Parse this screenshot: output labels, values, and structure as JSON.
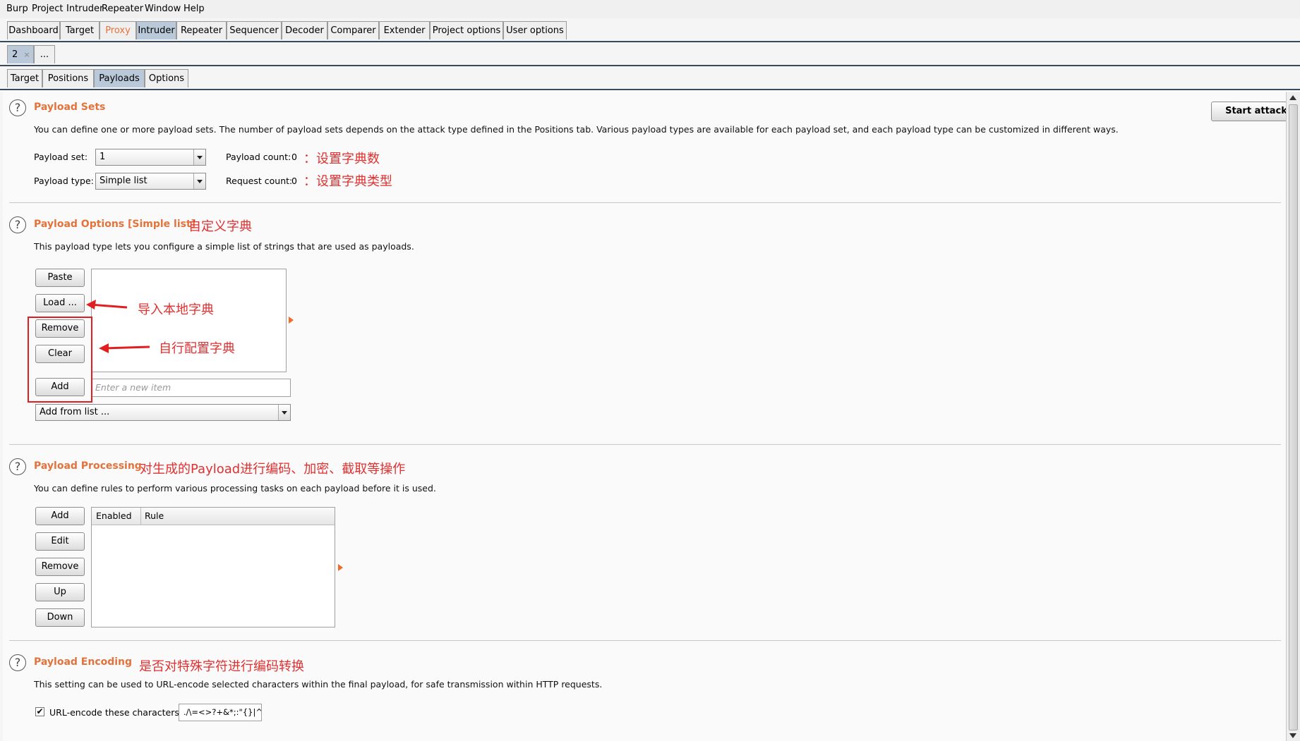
{
  "menu": [
    "Burp",
    "Project",
    "Intruder",
    "Repeater",
    "Window",
    "Help"
  ],
  "main_tabs": [
    "Dashboard",
    "Target",
    "Proxy",
    "Intruder",
    "Repeater",
    "Sequencer",
    "Decoder",
    "Comparer",
    "Extender",
    "Project options",
    "User options"
  ],
  "attack_tabs": {
    "current": "2",
    "close": "×",
    "more": "..."
  },
  "sub_tabs": [
    "Target",
    "Positions",
    "Payloads",
    "Options"
  ],
  "help_glyph": "?",
  "start_attack": "Start attack",
  "payload_sets": {
    "title": "Payload Sets",
    "description": "You can define one or more payload sets. The number of payload sets depends on the attack type defined in the Positions tab. Various payload types are available for each payload set, and each payload type can be customized in different ways.",
    "set_label": "Payload set:",
    "set_value": "1",
    "type_label": "Payload type:",
    "type_value": "Simple list",
    "count_label": "Payload count:",
    "count_value": "0",
    "request_label": "Request count:",
    "request_value": "0",
    "anno_count": "：设置字典数",
    "anno_type": "：设置字典类型"
  },
  "payload_options": {
    "title": "Payload Options [Simple list]",
    "anno_title": "自定义字典",
    "description": "This payload type lets you configure a simple list of strings that are used as payloads.",
    "buttons": [
      "Paste",
      "Load ...",
      "Remove",
      "Clear",
      "Add"
    ],
    "new_item_placeholder": "Enter a new item",
    "add_from_list": "Add from list ...",
    "anno_load": "导入本地字典",
    "anno_config": "自行配置字典"
  },
  "payload_processing": {
    "title": "Payload Processing",
    "anno_title": "对生成的Payload进行编码、加密、截取等操作",
    "description": "You can define rules to perform various processing tasks on each payload before it is used.",
    "buttons": [
      "Add",
      "Edit",
      "Remove",
      "Up",
      "Down"
    ],
    "columns": [
      "Enabled",
      "Rule"
    ]
  },
  "payload_encoding": {
    "title": "Payload Encoding",
    "anno_title": "是否对特殊字符进行编码转换",
    "description": "This setting can be used to URL-encode selected characters within the final payload, for safe transmission within HTTP requests.",
    "checkbox_label": "URL-encode these characters:",
    "checked": true,
    "characters": "./\\=<>?+&*;:\"{}|^`"
  },
  "colors": {
    "accent": "#e3733b",
    "annotation": "#e03030",
    "active_tab": "#b9c9da"
  }
}
